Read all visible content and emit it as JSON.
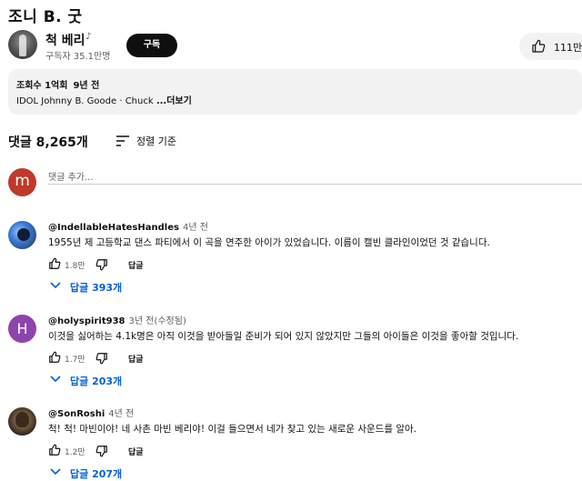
{
  "video": {
    "title": "조니 B. 굿",
    "channel_name": "척 베리",
    "channel_icon": "music-note-icon",
    "subscribers": "구독자 35.1만명",
    "subscribe_label": "구독",
    "likes": "111만"
  },
  "description": {
    "views": "조회수 1억회",
    "age": "9년 전",
    "text": "IDOL Johnny B. Goode · Chuck ",
    "more_label": "...더보기"
  },
  "comments_header": {
    "count": "댓글 8,265개",
    "sort_label": "정렬 기준"
  },
  "add_comment": {
    "avatar_letter": "m",
    "placeholder": "댓글 추가..."
  },
  "comments": [
    {
      "author": "@IndellableHatesHandles",
      "time": "4년 전",
      "text": "1955년 제 고등학교 댄스 파티에서 이 곡을 연주한 아이가 있었습니다. 이름이 캘빈 클라인이었던 것 같습니다.",
      "likes": "1.8만",
      "reply_label": "답글",
      "replies": "답글 393개"
    },
    {
      "author": "@holyspirit938",
      "avatar_letter": "H",
      "time": "3년 전(수정됨)",
      "text": "이것을 싫어하는 4.1k명은 아직 이것을 받아들일 준비가 되어 있지 않았지만 그들의 아이들은 이것을 좋아할 것입니다.",
      "likes": "1.7만",
      "reply_label": "답글",
      "replies": "답글 203개"
    },
    {
      "author": "@SonRoshi",
      "time": "4년 전",
      "text": "척! 척! 마빈이야! 네 사촌 마빈 베리야! 이걸 들으면서 네가 찾고 있는 새로운 사운드를 알아.",
      "likes": "1.2만",
      "reply_label": "답글",
      "replies": "답글 207개"
    }
  ],
  "colors": {
    "subscribe_bg": "#0f0f0f",
    "replies_link": "#065fd4",
    "my_avatar": "#c0392b",
    "letter_avatar": "#8e44ad"
  }
}
